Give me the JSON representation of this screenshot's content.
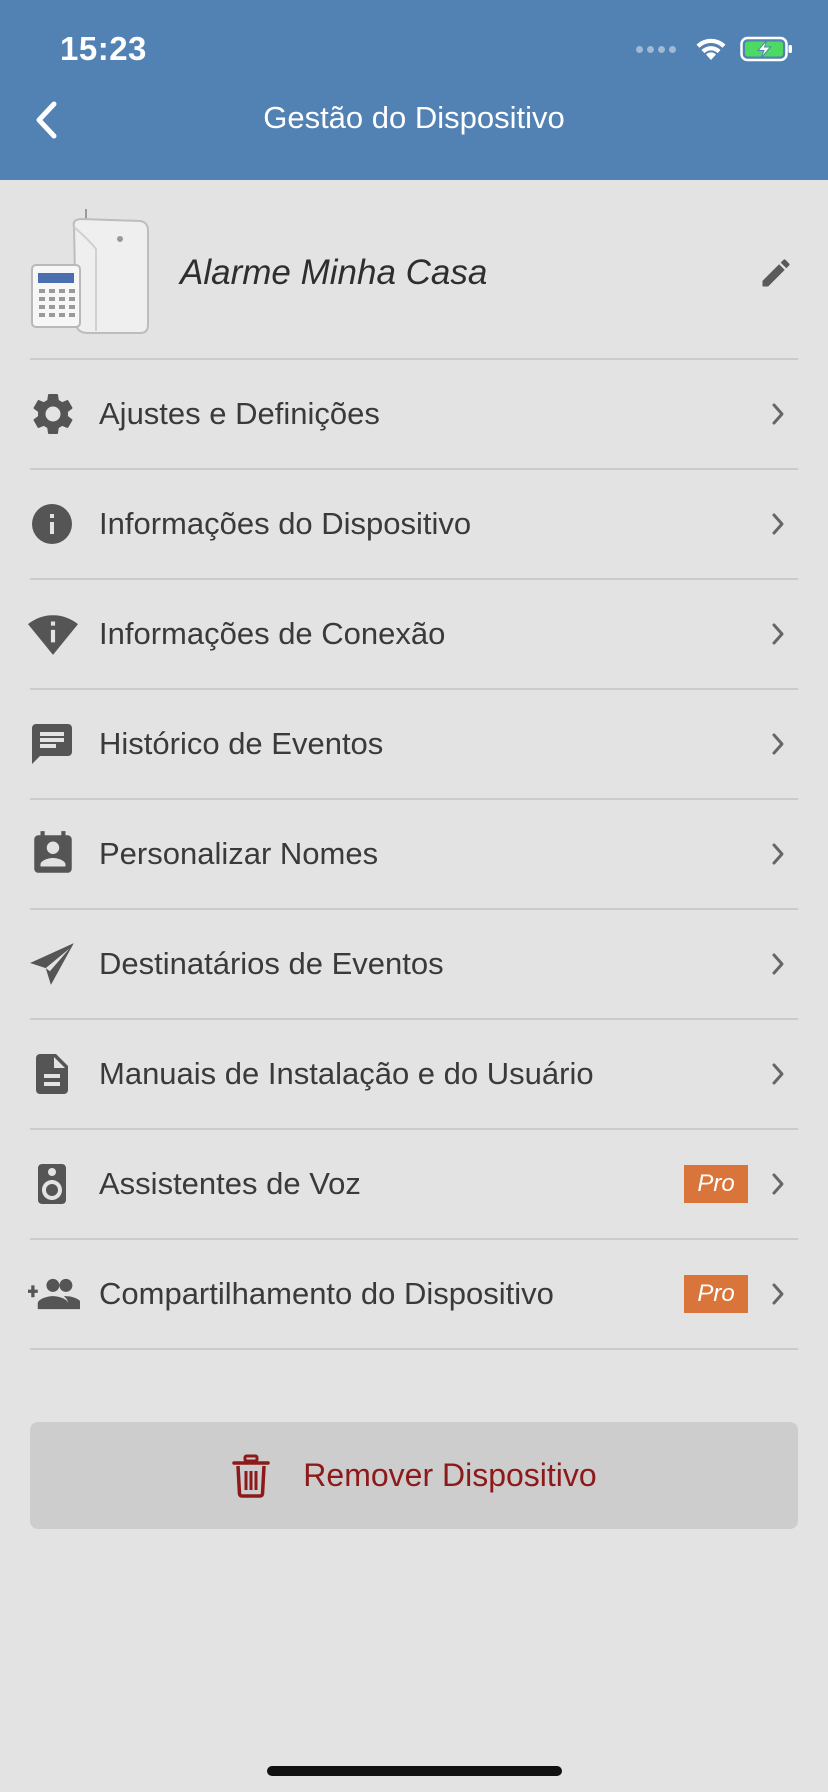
{
  "status_bar": {
    "time": "15:23"
  },
  "header": {
    "title": "Gestão do Dispositivo",
    "background": "#5281b3"
  },
  "device": {
    "name": "Alarme Minha Casa"
  },
  "menu": {
    "items": [
      {
        "label": "Ajustes e Definições",
        "icon": "gear-icon",
        "pro": false
      },
      {
        "label": "Informações do Dispositivo",
        "icon": "info-icon",
        "pro": false
      },
      {
        "label": "Informações de Conexão",
        "icon": "wifi-info-icon",
        "pro": false
      },
      {
        "label": "Histórico de Eventos",
        "icon": "message-icon",
        "pro": false
      },
      {
        "label": "Personalizar Nomes",
        "icon": "contact-card-icon",
        "pro": false
      },
      {
        "label": "Destinatários de Eventos",
        "icon": "send-icon",
        "pro": false
      },
      {
        "label": "Manuais de Instalação e do Usuário",
        "icon": "document-icon",
        "pro": false
      },
      {
        "label": "Assistentes de Voz",
        "icon": "speaker-icon",
        "pro": true
      },
      {
        "label": "Compartilhamento do Dispositivo",
        "icon": "add-user-icon",
        "pro": true
      }
    ],
    "pro_label": "Pro",
    "pro_color": "#d9753a"
  },
  "remove_button": {
    "label": "Remover Dispositivo",
    "color": "#8c1a1a"
  }
}
